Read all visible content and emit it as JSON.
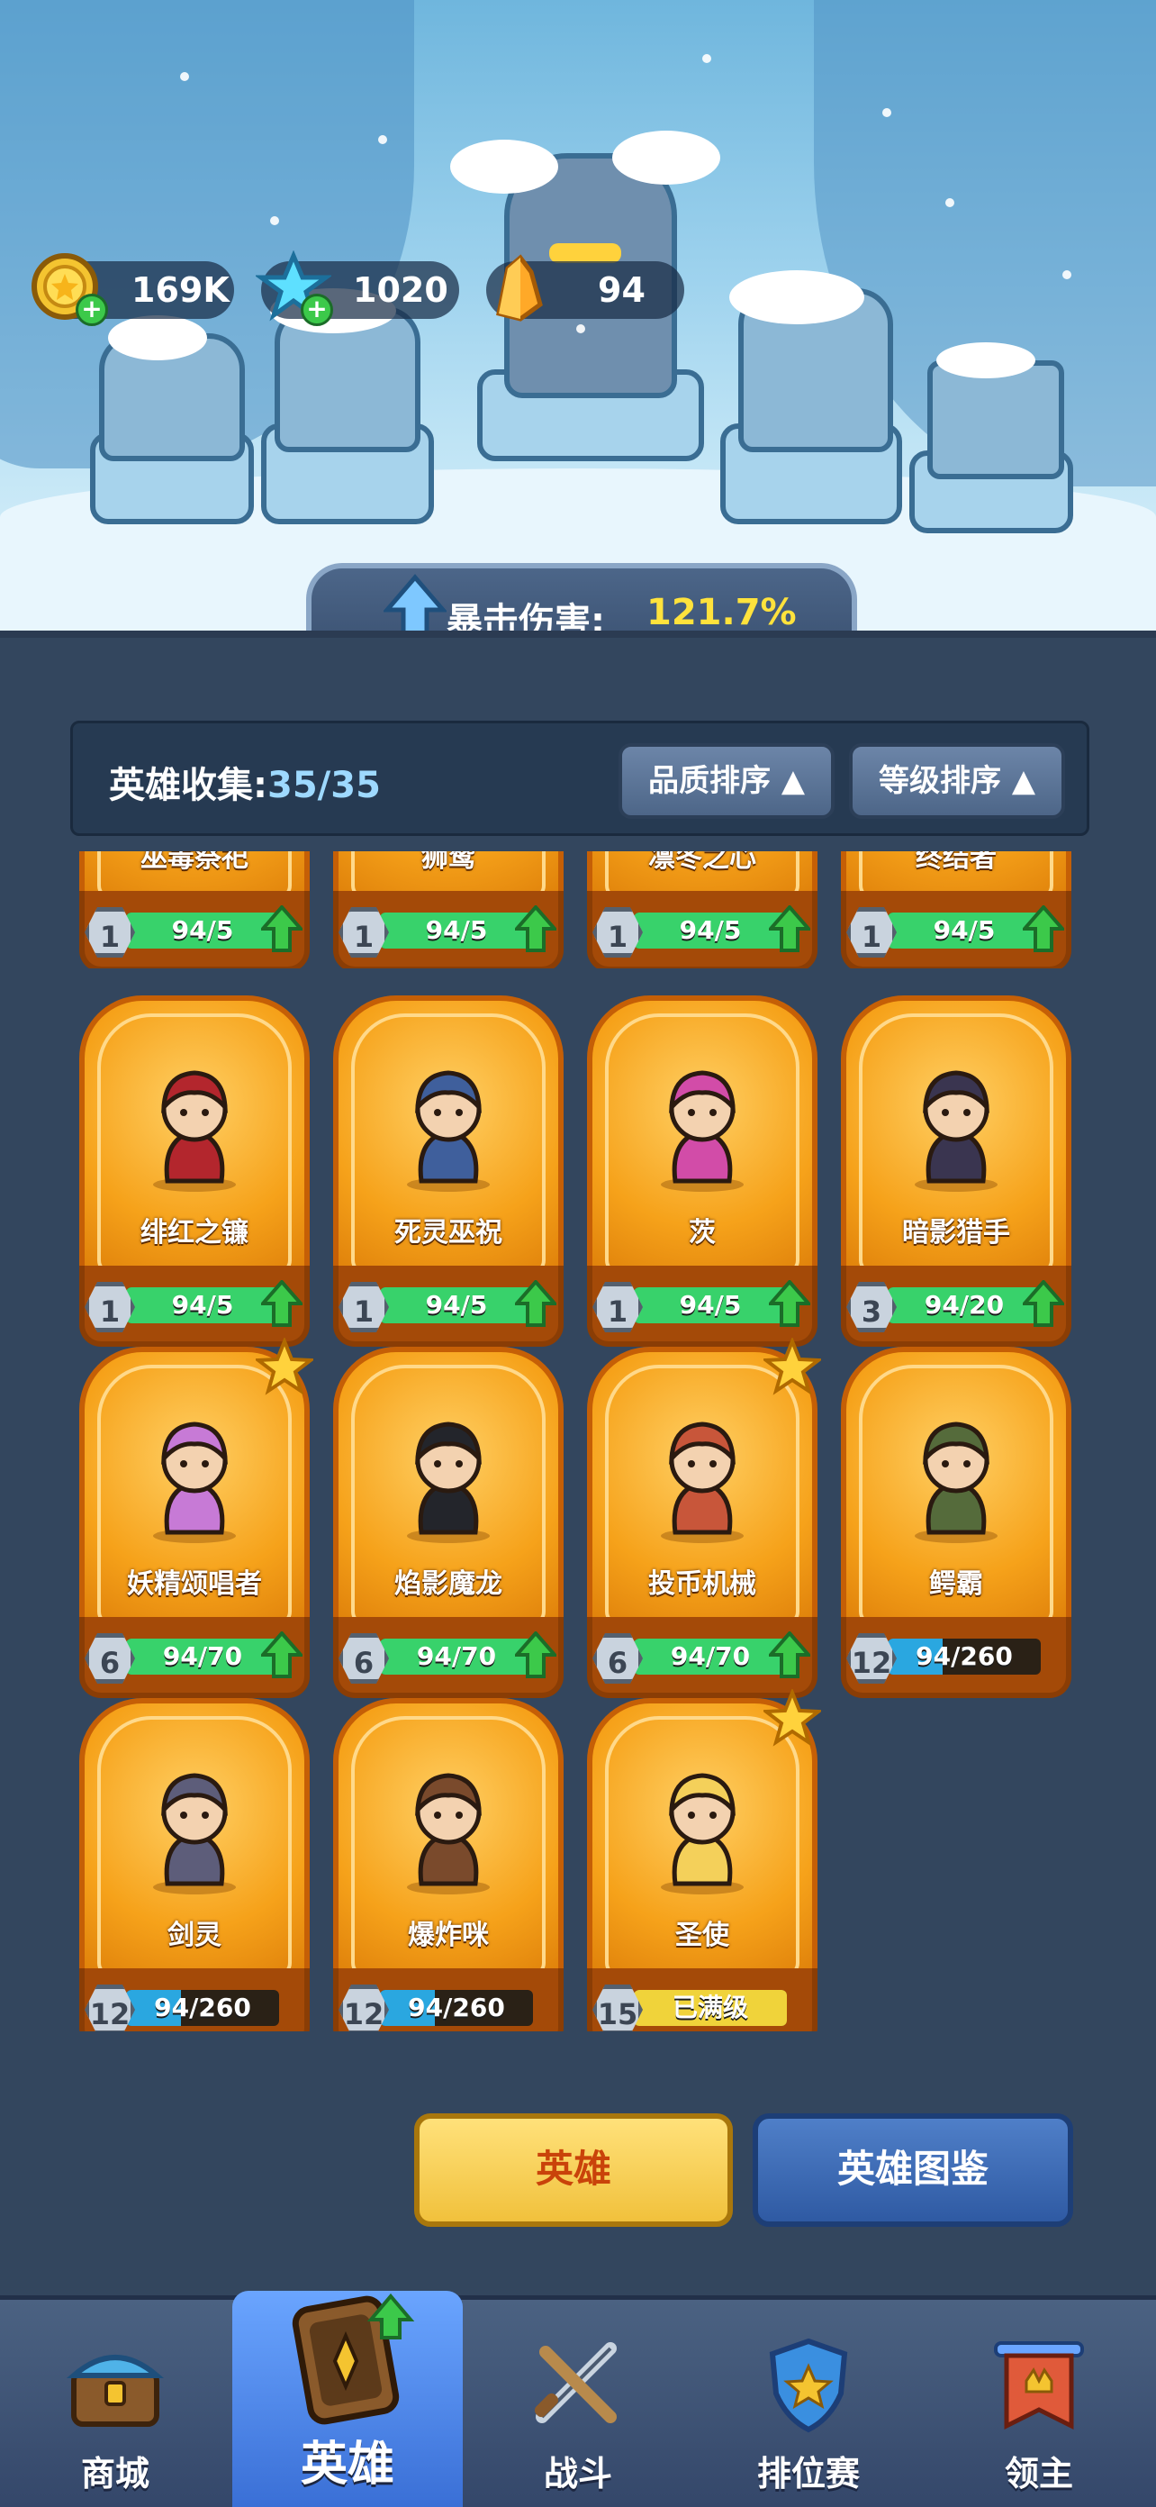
{
  "resources": {
    "gold": "169K",
    "gems": "1020",
    "crystals": "94"
  },
  "crit": {
    "label": "暴击伤害:",
    "value": "121.7%"
  },
  "collection": {
    "label": "英雄收集:",
    "count": "35/35",
    "sort_quality": "品质排序",
    "sort_level": "等级排序"
  },
  "partial_row": [
    {
      "name": "巫毒祭祀",
      "level": "1",
      "progress": "94/5",
      "fill": 1.0,
      "upgrade": true
    },
    {
      "name": "狮鹫",
      "level": "1",
      "progress": "94/5",
      "fill": 1.0,
      "upgrade": true
    },
    {
      "name": "凛冬之心",
      "level": "1",
      "progress": "94/5",
      "fill": 1.0,
      "upgrade": true
    },
    {
      "name": "终结者",
      "level": "1",
      "progress": "94/5",
      "fill": 1.0,
      "upgrade": true
    }
  ],
  "heroes": [
    {
      "name": "绯红之镰",
      "level": "1",
      "progress": "94/5",
      "fill": 1.0,
      "upgrade": true,
      "star": false,
      "icon": "scythe-demon-icon",
      "color": "#b3262d"
    },
    {
      "name": "死灵巫祝",
      "level": "1",
      "progress": "94/5",
      "fill": 1.0,
      "upgrade": true,
      "star": false,
      "icon": "necromancer-icon",
      "color": "#3f5f9c"
    },
    {
      "name": "茨",
      "level": "1",
      "progress": "94/5",
      "fill": 1.0,
      "upgrade": true,
      "star": false,
      "icon": "witch-girl-icon",
      "color": "#d24ca8"
    },
    {
      "name": "暗影猎手",
      "level": "3",
      "progress": "94/20",
      "fill": 1.0,
      "upgrade": true,
      "star": false,
      "icon": "shadow-hunter-icon",
      "color": "#3a3550"
    },
    {
      "name": "妖精颂唱者",
      "level": "6",
      "progress": "94/70",
      "fill": 1.0,
      "upgrade": true,
      "star": true,
      "icon": "fairy-singer-icon",
      "color": "#c77ad6"
    },
    {
      "name": "焰影魔龙",
      "level": "6",
      "progress": "94/70",
      "fill": 1.0,
      "upgrade": true,
      "star": false,
      "icon": "shadow-dragon-icon",
      "color": "#23252b"
    },
    {
      "name": "投币机械",
      "level": "6",
      "progress": "94/70",
      "fill": 1.0,
      "upgrade": true,
      "star": true,
      "icon": "slot-machine-icon",
      "color": "#c8563a"
    },
    {
      "name": "鳄霸",
      "level": "12",
      "progress": "94/260",
      "fill": 0.36,
      "upgrade": false,
      "star": false,
      "icon": "croc-brute-icon",
      "color": "#556b3b"
    },
    {
      "name": "剑灵",
      "level": "12",
      "progress": "94/260",
      "fill": 0.36,
      "upgrade": false,
      "star": false,
      "icon": "sword-spirit-icon",
      "color": "#5d5d7a"
    },
    {
      "name": "爆炸咪",
      "level": "12",
      "progress": "94/260",
      "fill": 0.36,
      "upgrade": false,
      "star": false,
      "icon": "bomb-cat-icon",
      "color": "#7a4a2c"
    },
    {
      "name": "圣使",
      "level": "15",
      "progress": "已满级",
      "fill": 1.0,
      "upgrade": false,
      "star": true,
      "maxed": true,
      "icon": "angel-icon",
      "color": "#f4d05a"
    }
  ],
  "actions": {
    "hero": "英雄",
    "codex": "英雄图鉴"
  },
  "nav": [
    {
      "label": "商城",
      "icon": "chest-icon"
    },
    {
      "label": "英雄",
      "icon": "hero-card-icon"
    },
    {
      "label": "战斗",
      "icon": "crossed-swords-icon"
    },
    {
      "label": "排位赛",
      "icon": "rank-shield-icon"
    },
    {
      "label": "领主",
      "icon": "banner-icon"
    }
  ],
  "colors": {
    "progress_green": "#38d26b",
    "progress_blue": "#2aa7e0",
    "maxed_yellow": "#f0d33a",
    "card_orange": "#f6a21a"
  }
}
